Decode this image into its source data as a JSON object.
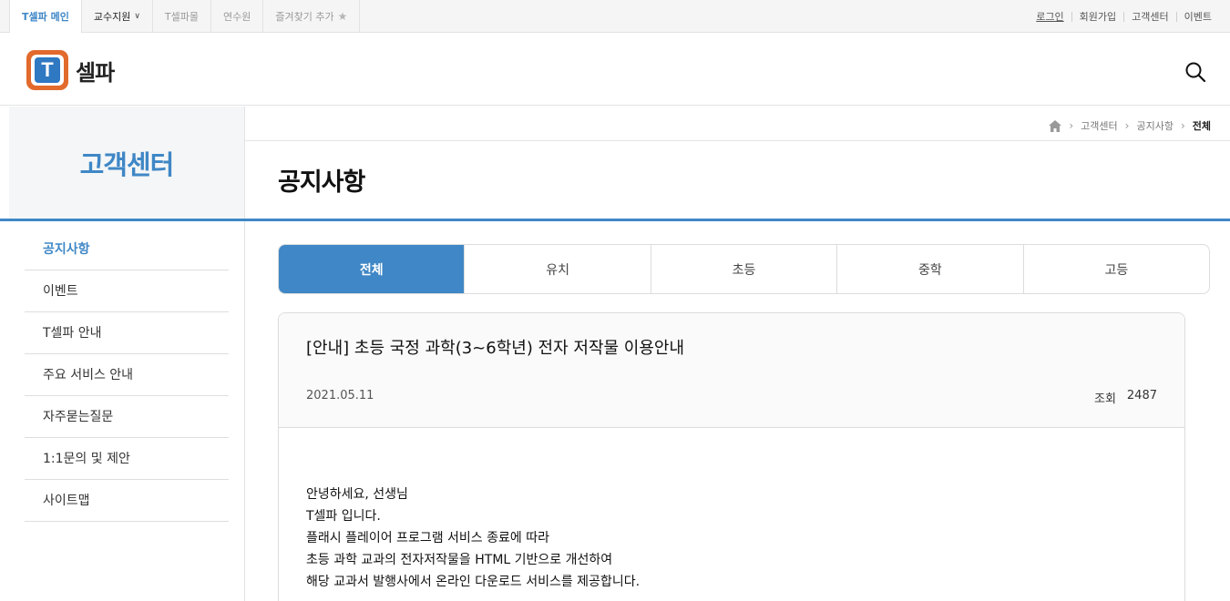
{
  "topbar": {
    "tabs": [
      {
        "label": "T셀파 메인"
      },
      {
        "label": "교수지원"
      },
      {
        "label": "T셀파몰"
      },
      {
        "label": "연수원"
      },
      {
        "label": "즐겨찾기 추가"
      }
    ],
    "links": [
      "로그인",
      "회원가입",
      "고객센터",
      "이벤트"
    ]
  },
  "header": {
    "logo_mark": "T",
    "logo_text": "셀파"
  },
  "sidebar": {
    "title": "고객센터",
    "items": [
      "공지사항",
      "이벤트",
      "T셀파 안내",
      "주요 서비스 안내",
      "자주묻는질문",
      "1:1문의 및 제안",
      "사이트맵"
    ]
  },
  "breadcrumb": {
    "items": [
      "고객센터",
      "공지사항"
    ],
    "current": "전체"
  },
  "main": {
    "title": "공지사항",
    "tabs": [
      "전체",
      "유치",
      "초등",
      "중학",
      "고등"
    ]
  },
  "article": {
    "title": "[안내] 초등 국정 과학(3~6학년) 전자 저작물 이용안내",
    "date": "2021.05.11",
    "views_label": "조회",
    "views": "2487",
    "body": [
      "안녕하세요, 선생님",
      "T셀파 입니다.",
      "플래시 플레이어 프로그램 서비스 종료에 따라",
      "초등 과학 교과의 전자저작물을 HTML 기반으로 개선하여",
      "해당 교과서 발행사에서 온라인 다운로드 서비스를 제공합니다."
    ]
  },
  "colors": {
    "accent": "#3f87c6",
    "logo_orange": "#e26a2c",
    "logo_blue": "#2f78c2"
  }
}
